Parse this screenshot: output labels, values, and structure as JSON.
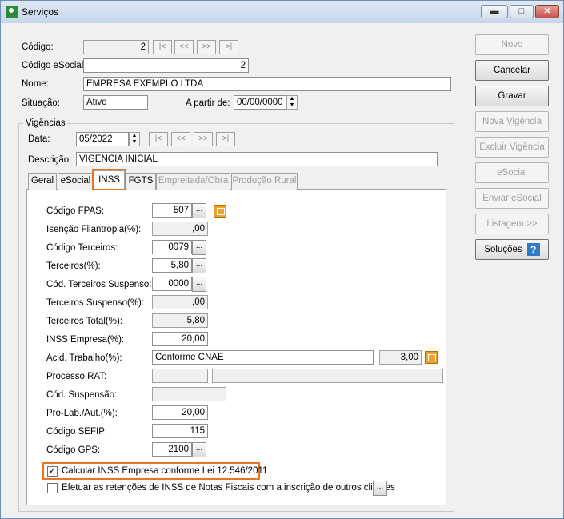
{
  "window": {
    "title": "Serviços"
  },
  "controls": {
    "min": "▬",
    "max": "□",
    "close": "✕"
  },
  "nav": {
    "first": "|<",
    "prev": "<<",
    "next": ">>",
    "last": ">|"
  },
  "header": {
    "codigo_label": "Código:",
    "codigo_value": "2",
    "codigo_esocial_label": "Código eSocial:",
    "codigo_esocial_value": "2",
    "nome_label": "Nome:",
    "nome_value": "EMPRESA EXEMPLO LTDA",
    "situacao_label": "Situação:",
    "situacao_value": "Ativo",
    "apartir_label": "A partir de:",
    "apartir_value": "00/00/0000"
  },
  "vigencias": {
    "group_label": "Vigências",
    "data_label": "Data:",
    "data_value": "05/2022",
    "descricao_label": "Descrição:",
    "descricao_value": "VIGENCIA INICIAL"
  },
  "tabs": [
    "Geral",
    "eSocial",
    "INSS",
    "FGTS",
    "Empreitada/Obra",
    "Produção Rural"
  ],
  "inss": {
    "codigo_fpas_label": "Código FPAS:",
    "codigo_fpas_value": "507",
    "isencao_label": "Isenção Filantropia(%):",
    "isencao_value": ",00",
    "codigo_terceiros_label": "Código Terceiros:",
    "codigo_terceiros_value": "0079",
    "terceiros_label": "Terceiros(%):",
    "terceiros_value": "5,80",
    "cod_terc_susp_label": "Cód. Terceiros Suspenso:",
    "cod_terc_susp_value": "0000",
    "terc_susp_label": "Terceiros Suspenso(%):",
    "terc_susp_value": ",00",
    "terc_total_label": "Terceiros Total(%):",
    "terc_total_value": "5,80",
    "inss_empresa_label": "INSS Empresa(%):",
    "inss_empresa_value": "20,00",
    "acid_trabalho_label": "Acid. Trabalho(%):",
    "acid_trabalho_text": "Conforme CNAE",
    "acid_trabalho_value": "3,00",
    "processo_rat_label": "Processo RAT:",
    "cod_suspensao_label": "Cód. Suspensão:",
    "pro_lab_label": "Pró-Lab./Aut.(%):",
    "pro_lab_value": "20,00",
    "codigo_sefip_label": "Código SEFIP:",
    "codigo_sefip_value": "115",
    "codigo_gps_label": "Código GPS:",
    "codigo_gps_value": "2100",
    "calcular_label": "Calcular INSS Empresa conforme Lei 12.546/2011",
    "efetuar_label": "Efetuar as retenções de INSS de Notas Fiscais com a inscrição de outros clientes"
  },
  "ellipsis": "...",
  "sidebar": {
    "novo": "Novo",
    "cancelar": "Cancelar",
    "gravar": "Gravar",
    "nova_vigencia": "Nova Vigência",
    "excluir_vigencia": "Excluir Vigência",
    "esocial": "eSocial",
    "enviar_esocial": "Enviar eSocial",
    "listagem": "Listagem >>",
    "solucoes": "Soluções",
    "help": "?"
  },
  "colors": {
    "highlight": "#e8761f",
    "help_icon": "#2f7bc9"
  }
}
